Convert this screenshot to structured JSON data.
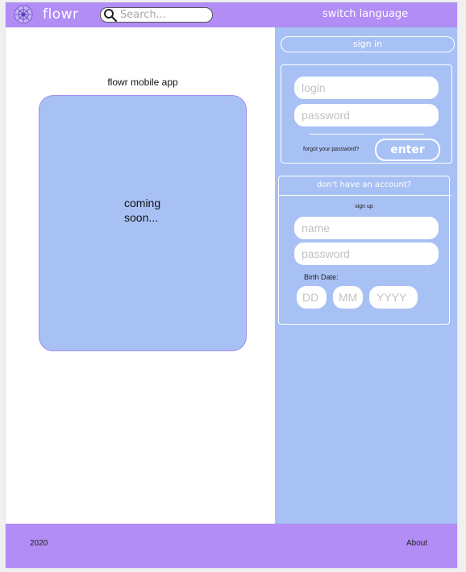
{
  "header": {
    "brand": "flowr",
    "search_placeholder": "Search...",
    "language_label": "switch language",
    "logo_icon": "flower-logo-icon",
    "search_icon": "search-icon"
  },
  "main": {
    "app_title": "flowr mobile app",
    "coming_line1": "coming",
    "coming_line2": "soon..."
  },
  "sidebar": {
    "signin_label": "sign in",
    "login_placeholder": "login",
    "password_placeholder": "password",
    "forgot_label": "forgot your password?",
    "enter_label": "enter",
    "signup_title": "don't have an account?",
    "signup_link": "sign up",
    "name_placeholder": "name",
    "signup_password_placeholder": "password",
    "birth_label": "Birth Date:",
    "dd_placeholder": "DD",
    "mm_placeholder": "MM",
    "yyyy_placeholder": "YYYY"
  },
  "footer": {
    "year": "2020",
    "about_label": "About"
  },
  "colors": {
    "header_purple": "#b18df5",
    "sidebar_blue": "#a8c1f5",
    "phone_blue": "#a8c1f5",
    "white": "#ffffff"
  }
}
